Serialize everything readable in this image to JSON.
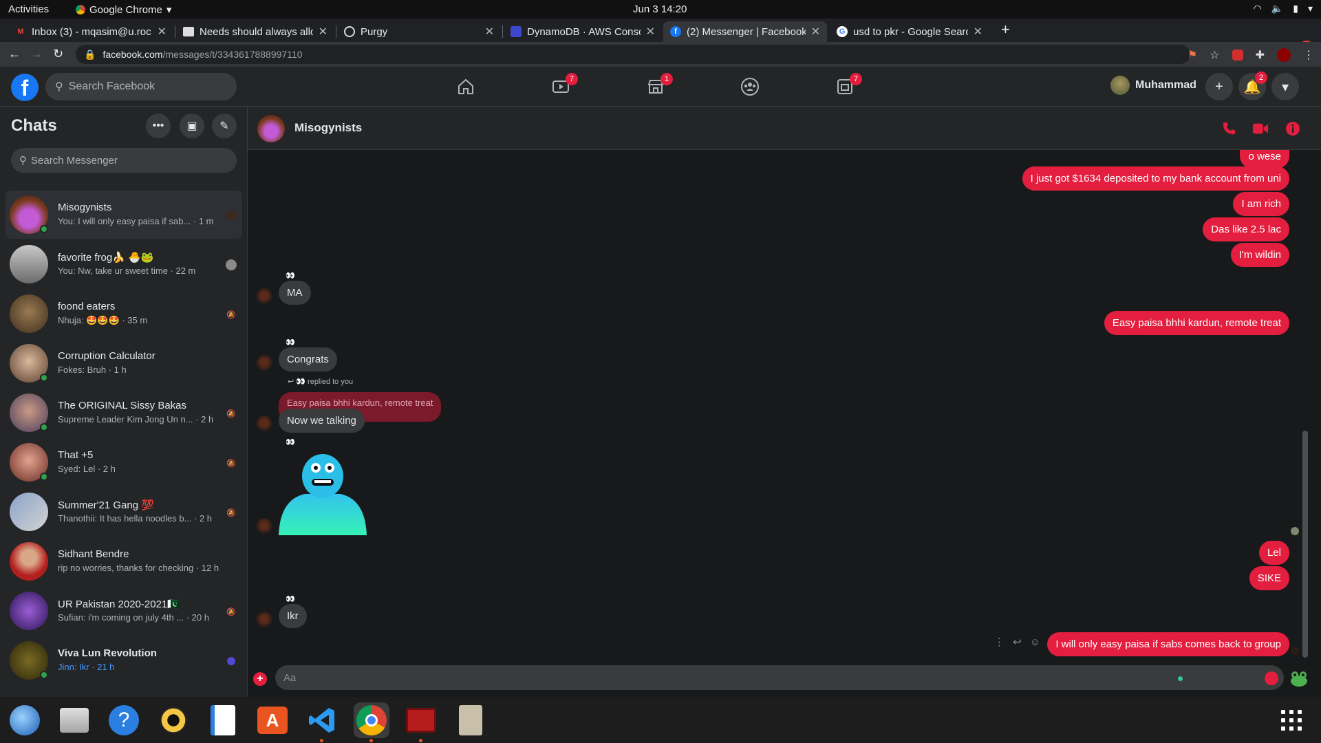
{
  "system": {
    "activities": "Activities",
    "app_name": "Google Chrome",
    "clock": "Jun 3  14:20"
  },
  "tabs": [
    {
      "title": "Inbox (3) - mqasim@u.roc",
      "favicon": "gmail-icon"
    },
    {
      "title": "Needs should always allo",
      "favicon": "page-icon"
    },
    {
      "title": "Purgy",
      "favicon": "globe-icon"
    },
    {
      "title": "DynamoDB · AWS Console",
      "favicon": "dynamodb-icon"
    },
    {
      "title": "(2) Messenger | Facebook",
      "favicon": "facebook-icon",
      "active": true
    },
    {
      "title": "usd to pkr - Google Search",
      "favicon": "google-icon"
    }
  ],
  "address": {
    "host": "facebook.com",
    "path": "/messages/t/3343617888997110"
  },
  "fb_header": {
    "search_placeholder": "Search Facebook",
    "watch_badge": "7",
    "marketplace_badge": "1",
    "gaming_badge": "7",
    "profile_name": "Muhammad",
    "notifications_badge": "2"
  },
  "sidebar": {
    "title": "Chats",
    "search_placeholder": "Search Messenger",
    "chats": [
      {
        "name": "Misogynists",
        "preview": "You: I will only easy paisa if sab... · 1 m"
      },
      {
        "name": "favorite frog🍌 🐣🐸",
        "preview": "You: Nw, take ur sweet time · 22 m"
      },
      {
        "name": "foond eaters",
        "preview": "Nhuja: 🤩🤩🤩 · 35 m"
      },
      {
        "name": "Corruption Calculator",
        "preview": "Fokes: Bruh · 1 h"
      },
      {
        "name": "The ORIGINAL Sissy Bakas",
        "preview": "Supreme Leader Kim Jong Un n... · 2 h"
      },
      {
        "name": "That +5",
        "preview": "Syed: Lel · 2 h"
      },
      {
        "name": "Summer'21 Gang 💯",
        "preview": "Thanothii: It has hella noodles b... · 2 h"
      },
      {
        "name": "Sidhant Bendre",
        "preview": "rip no worries, thanks for checking · 12 h"
      },
      {
        "name": "UR Pakistan 2020-2021🇵🇰",
        "preview": "Sufian: i'm coming on july 4th ... · 20 h"
      },
      {
        "name": "Viva Lun Revolution",
        "preview": "Jinn: Ikr · 21 h"
      }
    ]
  },
  "conversation": {
    "title": "Misogynists",
    "messages": {
      "out1": "o wese",
      "out2": "I just got $1634 deposited to my bank account from uni",
      "out3": "I am rich",
      "out4": "Das like 2.5 lac",
      "out5": "I'm wildin",
      "in1_sender": "👀",
      "in1": "MA",
      "out6": "Easy paisa bhhi kardun, remote treat",
      "in2_sender": "👀",
      "in2": "Congrats",
      "reply_note": "👀 replied to you",
      "quoted": "Easy paisa bhhi kardun, remote treat",
      "in3": "Now we talking",
      "sticker_sender": "👀",
      "out7": "Lel",
      "out8": "SIKE",
      "in4_sender": "👀",
      "in4": "Ikr",
      "out9": "I will only easy paisa if sabs comes back to group"
    },
    "composer_placeholder": "Aa"
  },
  "colors": {
    "accent": "#e41e3f",
    "fb_blue": "#1877f2",
    "online": "#31a24c"
  }
}
